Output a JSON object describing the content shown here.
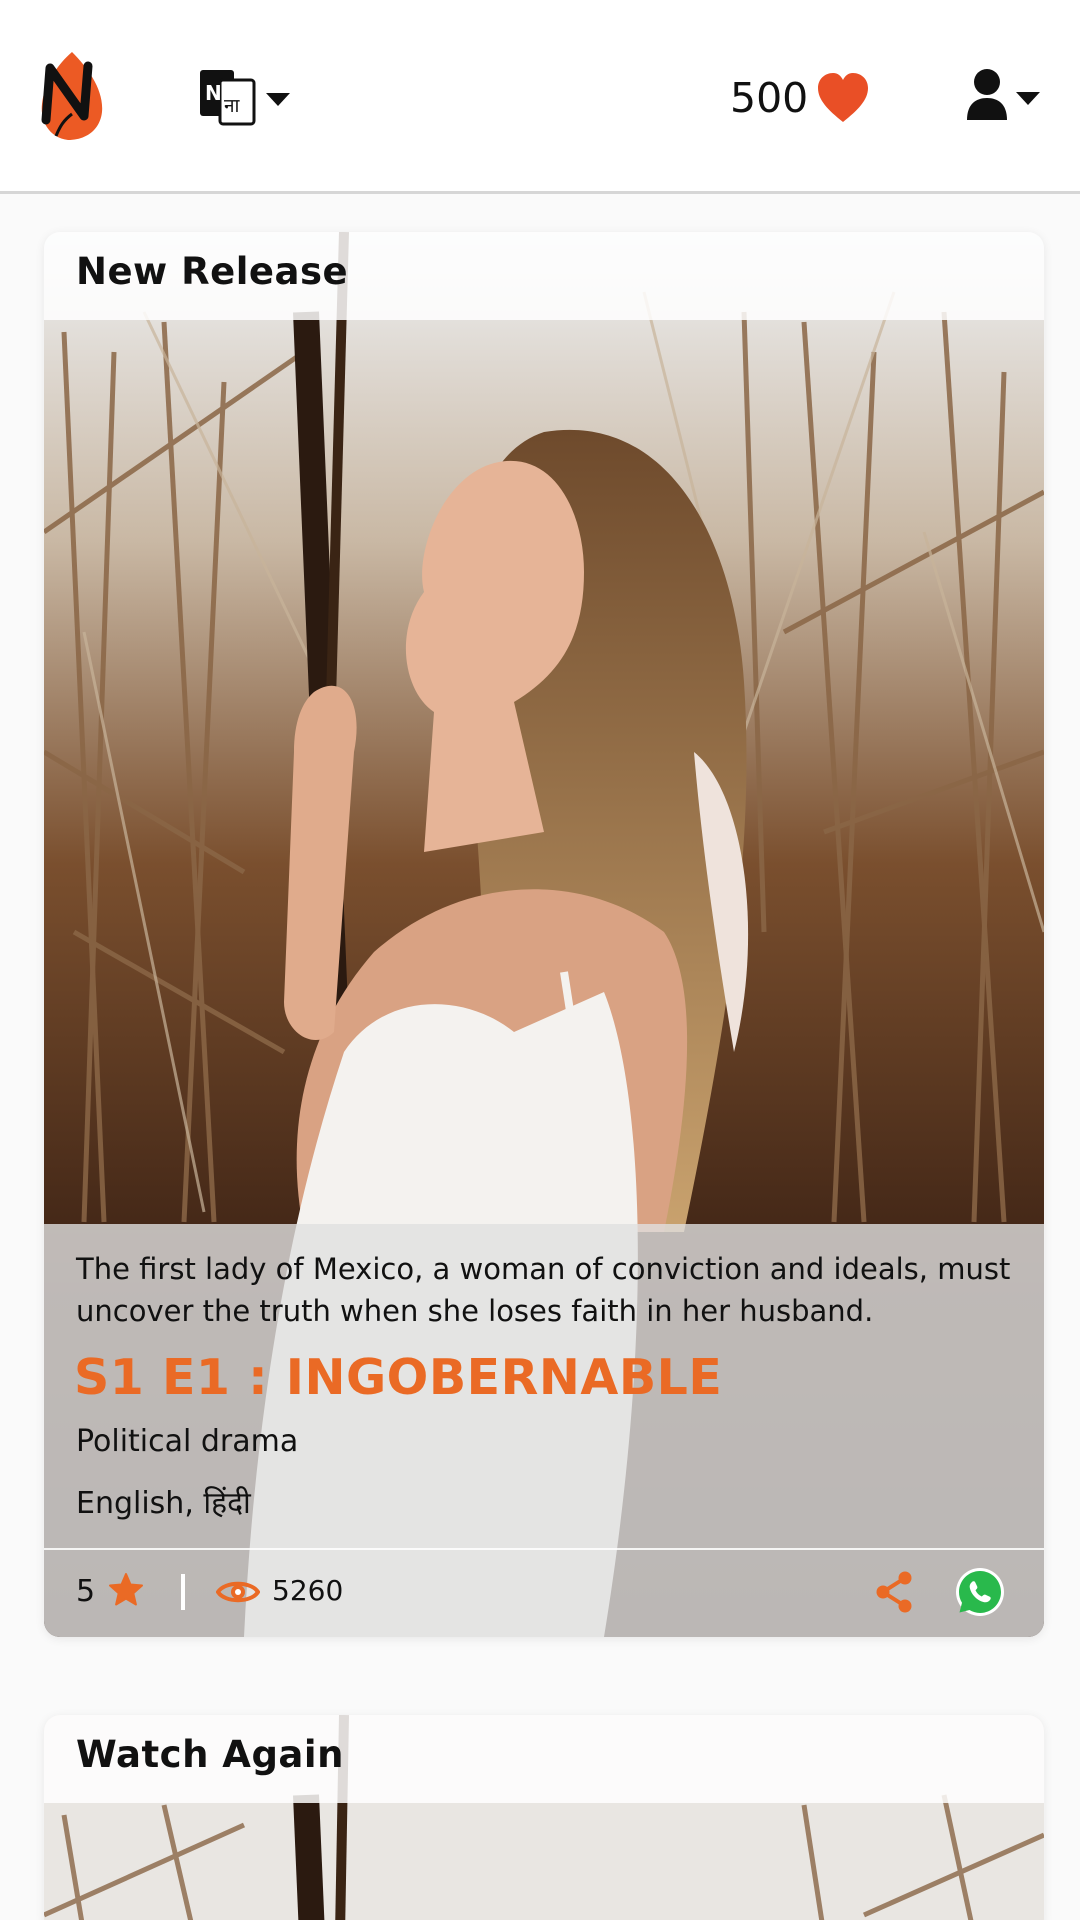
{
  "header": {
    "coins": "500",
    "lang_icon_text": "Nना",
    "colors": {
      "accent": "#ea6a25",
      "heart": "#e94f26"
    }
  },
  "icons": {
    "logo": "app-logo",
    "language": "language-switch-icon",
    "heart": "heart-icon",
    "user": "user-icon",
    "star": "star-icon",
    "eye": "eye-icon",
    "share": "share-icon",
    "whatsapp": "whatsapp-icon"
  },
  "cards": [
    {
      "title": "New Release",
      "description": "The first lady of Mexico, a woman of conviction and ideals, must uncover the truth when she loses faith in her husband.",
      "episode_title": "S1 E1 : INGOBERNABLE",
      "genre": "Political drama",
      "languages": "English, हिंदी",
      "rating": "5",
      "views": "5260"
    },
    {
      "title": "Watch Again"
    }
  ]
}
